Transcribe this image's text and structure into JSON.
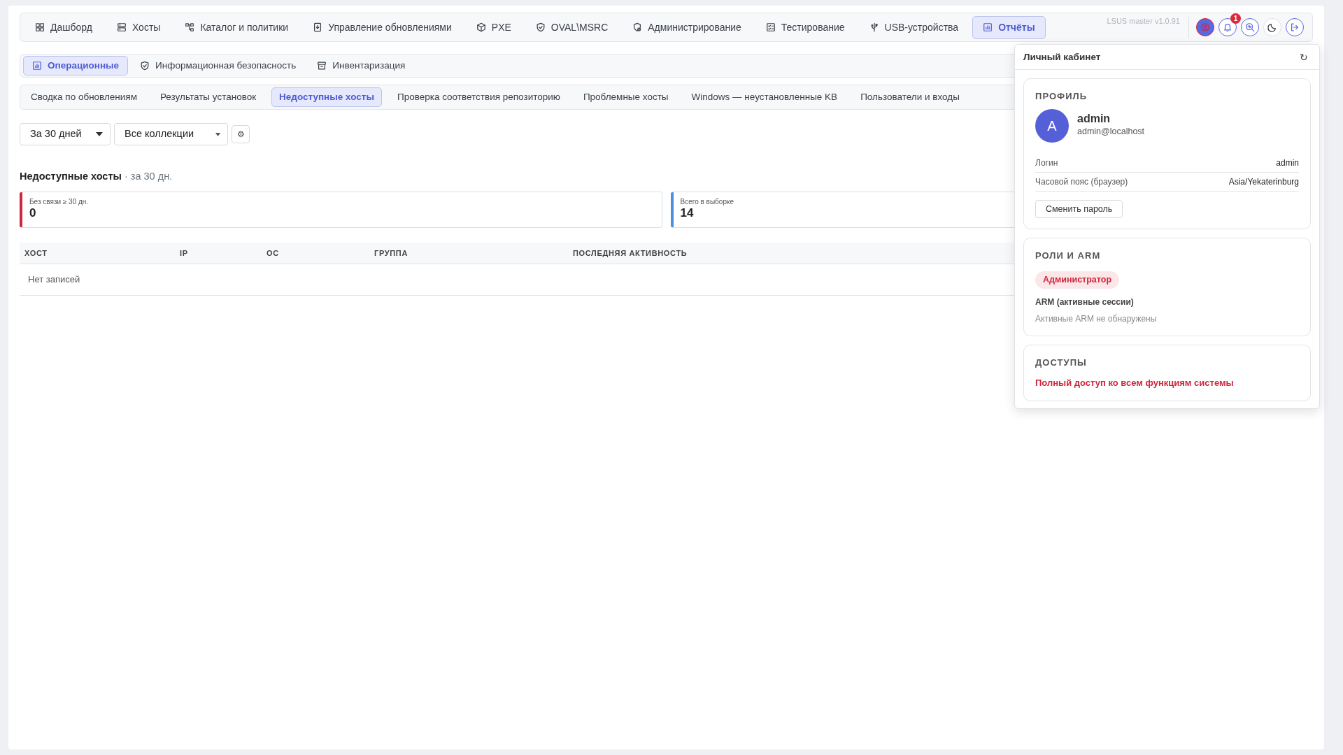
{
  "nav": {
    "items": [
      {
        "label": "Дашборд",
        "selected": false
      },
      {
        "label": "Хосты",
        "selected": false
      },
      {
        "label": "Каталог и политики",
        "selected": false
      },
      {
        "label": "Управление обновлениями",
        "selected": false
      },
      {
        "label": "PXE",
        "selected": false
      },
      {
        "label": "OVAL\\MSRC",
        "selected": false
      },
      {
        "label": "Администрирование",
        "selected": false
      },
      {
        "label": "Тестирование",
        "selected": false
      },
      {
        "label": "USB-устройства",
        "selected": false
      },
      {
        "label": "Отчёты",
        "selected": true
      }
    ],
    "version": "LSUS master v1.0.91",
    "actions": [
      {
        "kind": "profile",
        "selected": true
      },
      {
        "kind": "notifications",
        "selected": false,
        "badge": "1"
      },
      {
        "kind": "search",
        "selected": false
      },
      {
        "kind": "theme",
        "selected": false
      },
      {
        "kind": "logout",
        "selected": false
      }
    ]
  },
  "report_groups": [
    {
      "label": "Операционные",
      "selected": true
    },
    {
      "label": "Информационная безопасность",
      "selected": false
    },
    {
      "label": "Инвентаризация",
      "selected": false
    }
  ],
  "report_tabs": [
    {
      "label": "Сводка по обновлениям",
      "selected": false
    },
    {
      "label": "Результаты установок",
      "selected": false
    },
    {
      "label": "Недоступные хосты",
      "selected": true
    },
    {
      "label": "Проверка соответствия репозиторию",
      "selected": false
    },
    {
      "label": "Проблемные хосты",
      "selected": false
    },
    {
      "label": "Windows — неустановленные KB",
      "selected": false
    },
    {
      "label": "Пользователи и входы",
      "selected": false
    }
  ],
  "filters": {
    "period": "За 30 дней",
    "collection": "Все коллекции",
    "settings_button": "⚙"
  },
  "heading": {
    "title": "Недоступные хосты",
    "suffix": "· за 30 дн."
  },
  "stats": [
    {
      "label": "Без связи ≥ 30 дн.",
      "value": "0",
      "color": "#d0263b"
    },
    {
      "label": "Всего в выборке",
      "value": "14",
      "color": "#4a8fe0"
    }
  ],
  "table": {
    "columns": [
      "ХОСТ",
      "IP",
      "ОС",
      "ГРУППА",
      "ПОСЛЕДНЯЯ АКТИВНОСТЬ"
    ],
    "empty_text": "Нет записей"
  },
  "profile_panel": {
    "title": "Личный кабинет",
    "refresh": "↻",
    "profile": {
      "heading": "ПРОФИЛЬ",
      "avatar": "A",
      "name": "admin",
      "email": "admin@localhost",
      "fields": [
        {
          "label": "Логин",
          "value": "admin"
        },
        {
          "label": "Часовой пояс (браузер)",
          "value": "Asia/Yekaterinburg"
        }
      ],
      "button": "Сменить пароль"
    },
    "roles": {
      "heading": "РОЛИ И ARM",
      "role_badges": [
        "Администратор"
      ],
      "arm_title": "ARM (активные сессии)",
      "arm_empty": "Активные ARM не обнаружены"
    },
    "access": {
      "heading": "ДОСТУПЫ",
      "text": "Полный доступ ко всем функциям системы"
    }
  }
}
